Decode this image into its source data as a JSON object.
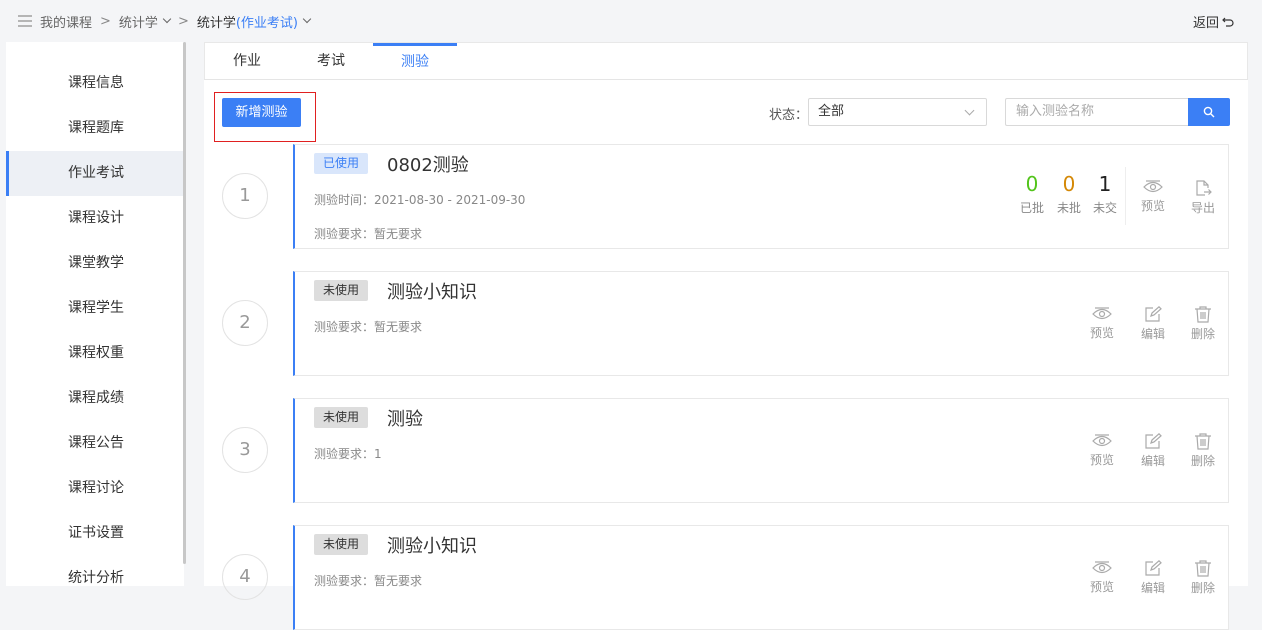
{
  "breadcrumb": {
    "home": "我的课程",
    "sep1": ">",
    "course": "统计学",
    "sep2": ">",
    "current_prefix": "统计学",
    "current_suffix": "(作业考试)",
    "back": "返回"
  },
  "sidebar": {
    "items": [
      {
        "label": "课程信息"
      },
      {
        "label": "课程题库"
      },
      {
        "label": "作业考试",
        "active": true
      },
      {
        "label": "课程设计"
      },
      {
        "label": "课堂教学"
      },
      {
        "label": "课程学生"
      },
      {
        "label": "课程权重"
      },
      {
        "label": "课程成绩"
      },
      {
        "label": "课程公告"
      },
      {
        "label": "课程讨论"
      },
      {
        "label": "证书设置"
      },
      {
        "label": "统计分析"
      }
    ]
  },
  "tabs": [
    {
      "label": "作业"
    },
    {
      "label": "考试"
    },
    {
      "label": "测验",
      "active": true
    }
  ],
  "toolbar": {
    "add_label": "新增测验",
    "status_label": "状态：",
    "status_value": "全部",
    "search_placeholder": "输入测验名称"
  },
  "actions": {
    "preview": "预览",
    "edit": "编辑",
    "delete": "删除",
    "export": "导出"
  },
  "stats_labels": {
    "graded": "已批",
    "ungraded": "未批",
    "unsubmitted": "未交"
  },
  "quizzes": [
    {
      "index": "1",
      "status": "已使用",
      "title": "0802测验",
      "time": "测验时间：2021-08-30 - 2021-09-30",
      "requirement": "测验要求：暂无要求",
      "graded": "0",
      "ungraded": "0",
      "unsubmitted": "1"
    },
    {
      "index": "2",
      "status": "未使用",
      "title": "测验小知识",
      "requirement": "测验要求：暂无要求"
    },
    {
      "index": "3",
      "status": "未使用",
      "title": "测验",
      "requirement": "测验要求：1"
    },
    {
      "index": "4",
      "status": "未使用",
      "title": "测验小知识",
      "requirement": "测验要求：暂无要求"
    }
  ],
  "colors": {
    "accent": "#3b7ff5",
    "graded": "#52c41a",
    "ungraded": "#d48806",
    "selection_outline": "#e02020"
  }
}
